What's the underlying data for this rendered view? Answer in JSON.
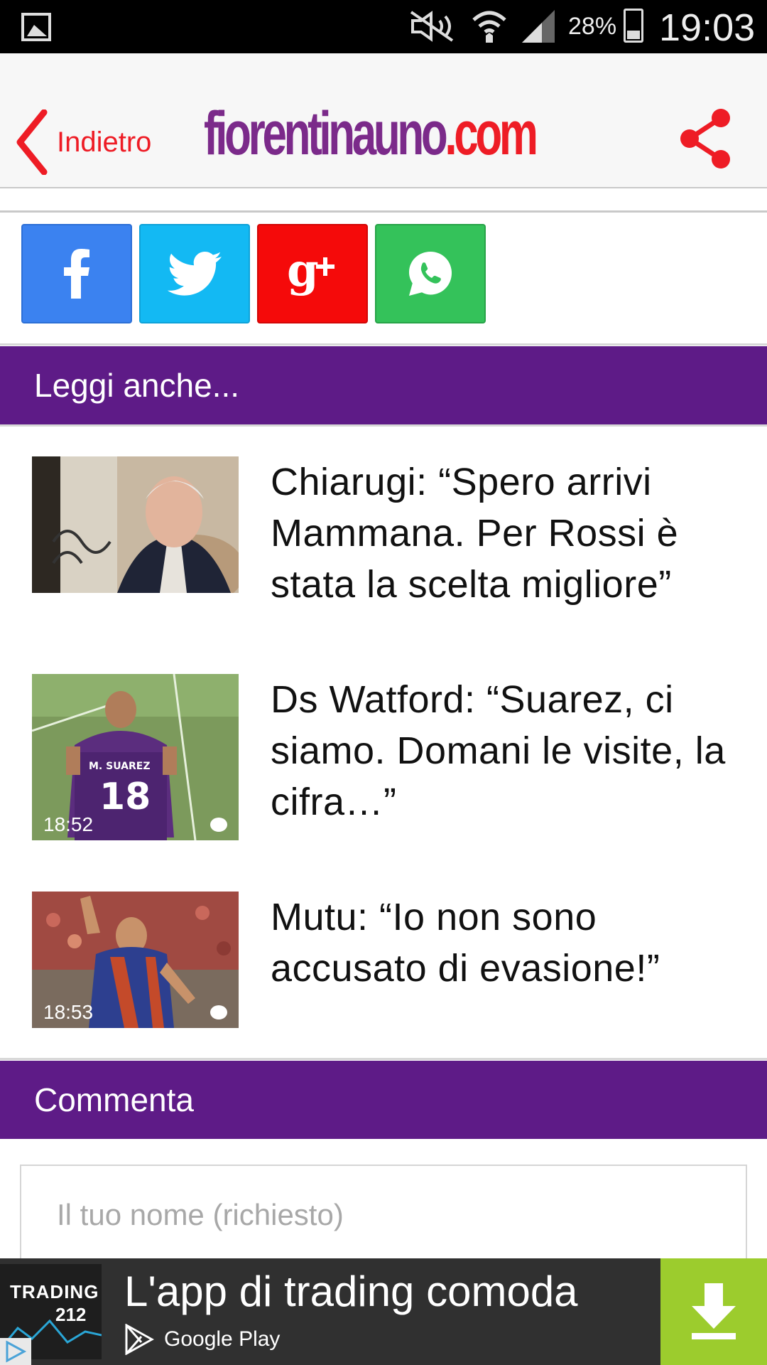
{
  "status_bar": {
    "battery_percent": "28%",
    "battery_level": 0.28,
    "time": "19:03",
    "icons": [
      "gallery-icon",
      "mute-icon",
      "wifi-icon",
      "signal-icon",
      "battery-icon"
    ]
  },
  "header": {
    "back_label": "Indietro",
    "logo_main": "fiorentinauno",
    "logo_tld": ".com",
    "accent_color": "#ee1c25",
    "brand_color": "#7b2a8a"
  },
  "share": {
    "buttons": [
      "facebook-icon",
      "twitter-icon",
      "google-plus-icon",
      "whatsapp-icon"
    ]
  },
  "related": {
    "header": "Leggi anche...",
    "articles": [
      {
        "title": "Chiarugi: “Spero arrivi Mammana. Per Rossi è stata la scelta migliore”",
        "time": ""
      },
      {
        "title": "Ds Watford: “Suarez, ci siamo. Domani le visite, la cifra…”",
        "time": "18:52"
      },
      {
        "title": "Mutu: “Io non sono accusato di evasione!”",
        "time": "18:53"
      }
    ]
  },
  "comment": {
    "header": "Commenta",
    "name_placeholder": "Il tuo nome (richiesto)"
  },
  "ad": {
    "logo_line1": "TRADING",
    "logo_line2": "212",
    "headline": "L'app di trading comoda",
    "store": "Google Play",
    "download_color": "#9ccc2d"
  },
  "section_color": "#5e1b87"
}
